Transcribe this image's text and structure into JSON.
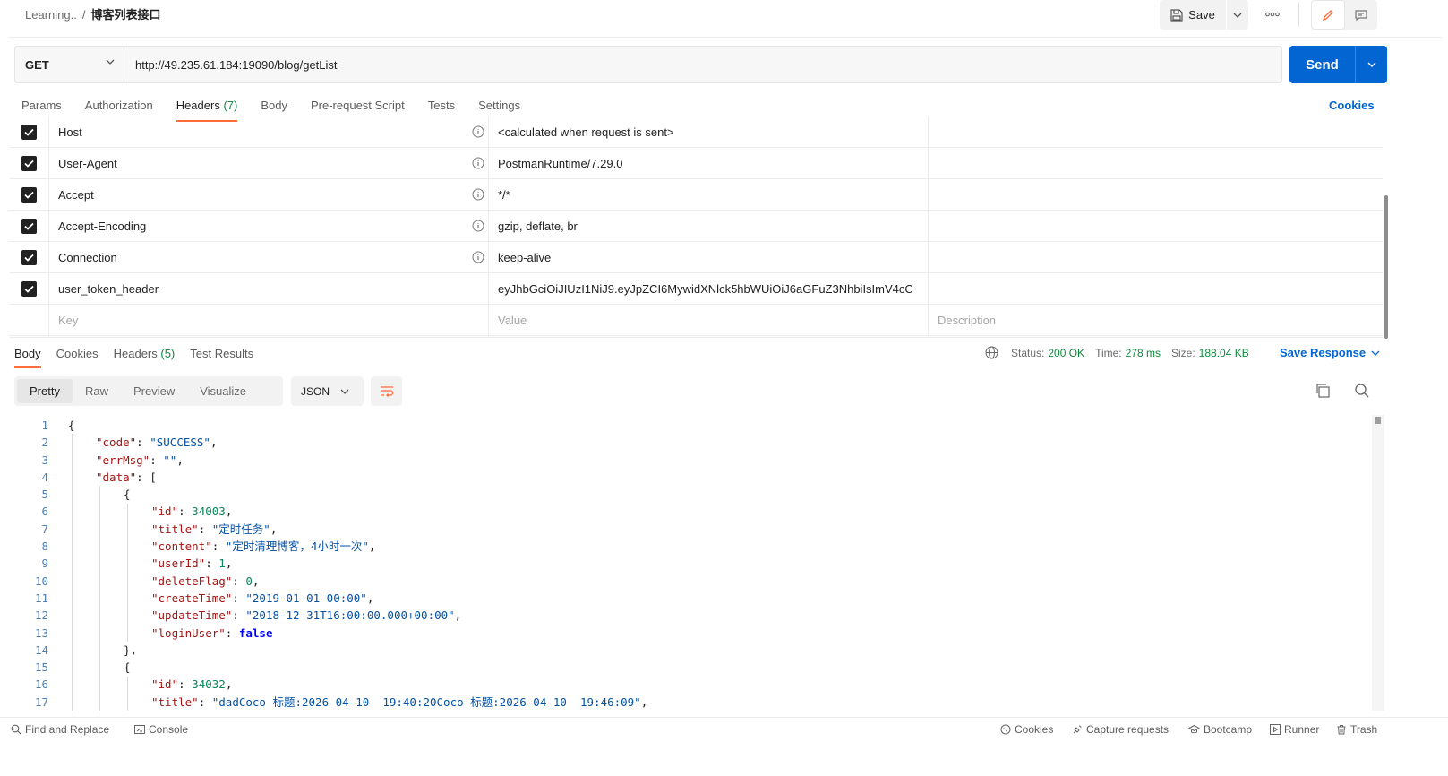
{
  "header": {
    "breadcrumb_parent": "Learning..",
    "breadcrumb_sep": "/",
    "title": "博客列表接口",
    "save_label": "Save"
  },
  "request": {
    "method": "GET",
    "url": "http://49.235.61.184:19090/blog/getList",
    "send_label": "Send"
  },
  "request_tabs": [
    {
      "label": "Params",
      "count": ""
    },
    {
      "label": "Authorization",
      "count": ""
    },
    {
      "label": "Headers",
      "count": "(7)"
    },
    {
      "label": "Body",
      "count": ""
    },
    {
      "label": "Pre-request Script",
      "count": ""
    },
    {
      "label": "Tests",
      "count": ""
    },
    {
      "label": "Settings",
      "count": ""
    }
  ],
  "cookies_label": "Cookies",
  "headers": [
    {
      "key": "Host",
      "value": "<calculated when request is sent>"
    },
    {
      "key": "User-Agent",
      "value": "PostmanRuntime/7.29.0"
    },
    {
      "key": "Accept",
      "value": "*/*"
    },
    {
      "key": "Accept-Encoding",
      "value": "gzip, deflate, br"
    },
    {
      "key": "Connection",
      "value": "keep-alive"
    },
    {
      "key": "user_token_header",
      "value": "eyJhbGciOiJIUzI1NiJ9.eyJpZCI6MywidXNlck5hbWUiOiJ6aGFuZ3NhbiIsImV4cC"
    }
  ],
  "headers_placeholder": {
    "key": "Key",
    "value": "Value",
    "description": "Description"
  },
  "response_tabs": [
    {
      "label": "Body",
      "count": ""
    },
    {
      "label": "Cookies",
      "count": ""
    },
    {
      "label": "Headers",
      "count": "(5)"
    },
    {
      "label": "Test Results",
      "count": ""
    }
  ],
  "response_meta": {
    "status_label": "Status:",
    "status": "200 OK",
    "time_label": "Time:",
    "time": "278 ms",
    "size_label": "Size:",
    "size": "188.04 KB",
    "save_response": "Save Response"
  },
  "view_tabs": [
    "Pretty",
    "Raw",
    "Preview",
    "Visualize"
  ],
  "format": "JSON",
  "code_lines": [
    {
      "n": "1",
      "indent": 0,
      "parts": [
        [
          "p",
          "{"
        ]
      ]
    },
    {
      "n": "2",
      "indent": 1,
      "parts": [
        [
          "k",
          "\"code\""
        ],
        [
          "p",
          ": "
        ],
        [
          "s",
          "\"SUCCESS\""
        ],
        [
          "p",
          ","
        ]
      ]
    },
    {
      "n": "3",
      "indent": 1,
      "parts": [
        [
          "k",
          "\"errMsg\""
        ],
        [
          "p",
          ": "
        ],
        [
          "s",
          "\"\""
        ],
        [
          "p",
          ","
        ]
      ]
    },
    {
      "n": "4",
      "indent": 1,
      "parts": [
        [
          "k",
          "\"data\""
        ],
        [
          "p",
          ": ["
        ]
      ]
    },
    {
      "n": "5",
      "indent": 2,
      "parts": [
        [
          "p",
          "{"
        ]
      ]
    },
    {
      "n": "6",
      "indent": 3,
      "parts": [
        [
          "k",
          "\"id\""
        ],
        [
          "p",
          ": "
        ],
        [
          "n",
          "34003"
        ],
        [
          "p",
          ","
        ]
      ]
    },
    {
      "n": "7",
      "indent": 3,
      "parts": [
        [
          "k",
          "\"title\""
        ],
        [
          "p",
          ": "
        ],
        [
          "s",
          "\"定时任务\""
        ],
        [
          "p",
          ","
        ]
      ]
    },
    {
      "n": "8",
      "indent": 3,
      "parts": [
        [
          "k",
          "\"content\""
        ],
        [
          "p",
          ": "
        ],
        [
          "s",
          "\"定时清理博客，4小时一次\""
        ],
        [
          "p",
          ","
        ]
      ]
    },
    {
      "n": "9",
      "indent": 3,
      "parts": [
        [
          "k",
          "\"userId\""
        ],
        [
          "p",
          ": "
        ],
        [
          "n",
          "1"
        ],
        [
          "p",
          ","
        ]
      ]
    },
    {
      "n": "10",
      "indent": 3,
      "parts": [
        [
          "k",
          "\"deleteFlag\""
        ],
        [
          "p",
          ": "
        ],
        [
          "n",
          "0"
        ],
        [
          "p",
          ","
        ]
      ]
    },
    {
      "n": "11",
      "indent": 3,
      "parts": [
        [
          "k",
          "\"createTime\""
        ],
        [
          "p",
          ": "
        ],
        [
          "s",
          "\"2019-01-01 00:00\""
        ],
        [
          "p",
          ","
        ]
      ]
    },
    {
      "n": "12",
      "indent": 3,
      "parts": [
        [
          "k",
          "\"updateTime\""
        ],
        [
          "p",
          ": "
        ],
        [
          "s",
          "\"2018-12-31T16:00:00.000+00:00\""
        ],
        [
          "p",
          ","
        ]
      ]
    },
    {
      "n": "13",
      "indent": 3,
      "parts": [
        [
          "k",
          "\"loginUser\""
        ],
        [
          "p",
          ": "
        ],
        [
          "b",
          "false"
        ]
      ]
    },
    {
      "n": "14",
      "indent": 2,
      "parts": [
        [
          "p",
          "},"
        ]
      ]
    },
    {
      "n": "15",
      "indent": 2,
      "parts": [
        [
          "p",
          "{"
        ]
      ]
    },
    {
      "n": "16",
      "indent": 3,
      "parts": [
        [
          "k",
          "\"id\""
        ],
        [
          "p",
          ": "
        ],
        [
          "n",
          "34032"
        ],
        [
          "p",
          ","
        ]
      ]
    },
    {
      "n": "17",
      "indent": 3,
      "parts": [
        [
          "k",
          "\"title\""
        ],
        [
          "p",
          ": "
        ],
        [
          "s",
          "\"dadCoco 标题:2026-04-10  19:40:20Coco 标题:2026-04-10  19:46:09\""
        ],
        [
          "p",
          ","
        ]
      ]
    }
  ],
  "footer": {
    "find_replace": "Find and Replace",
    "console": "Console",
    "cookies": "Cookies",
    "capture": "Capture requests",
    "bootcamp": "Bootcamp",
    "runner": "Runner",
    "trash": "Trash"
  },
  "colors": {
    "accent": "#ff6c37",
    "send": "#0265d2",
    "success": "#0f8a3e"
  }
}
